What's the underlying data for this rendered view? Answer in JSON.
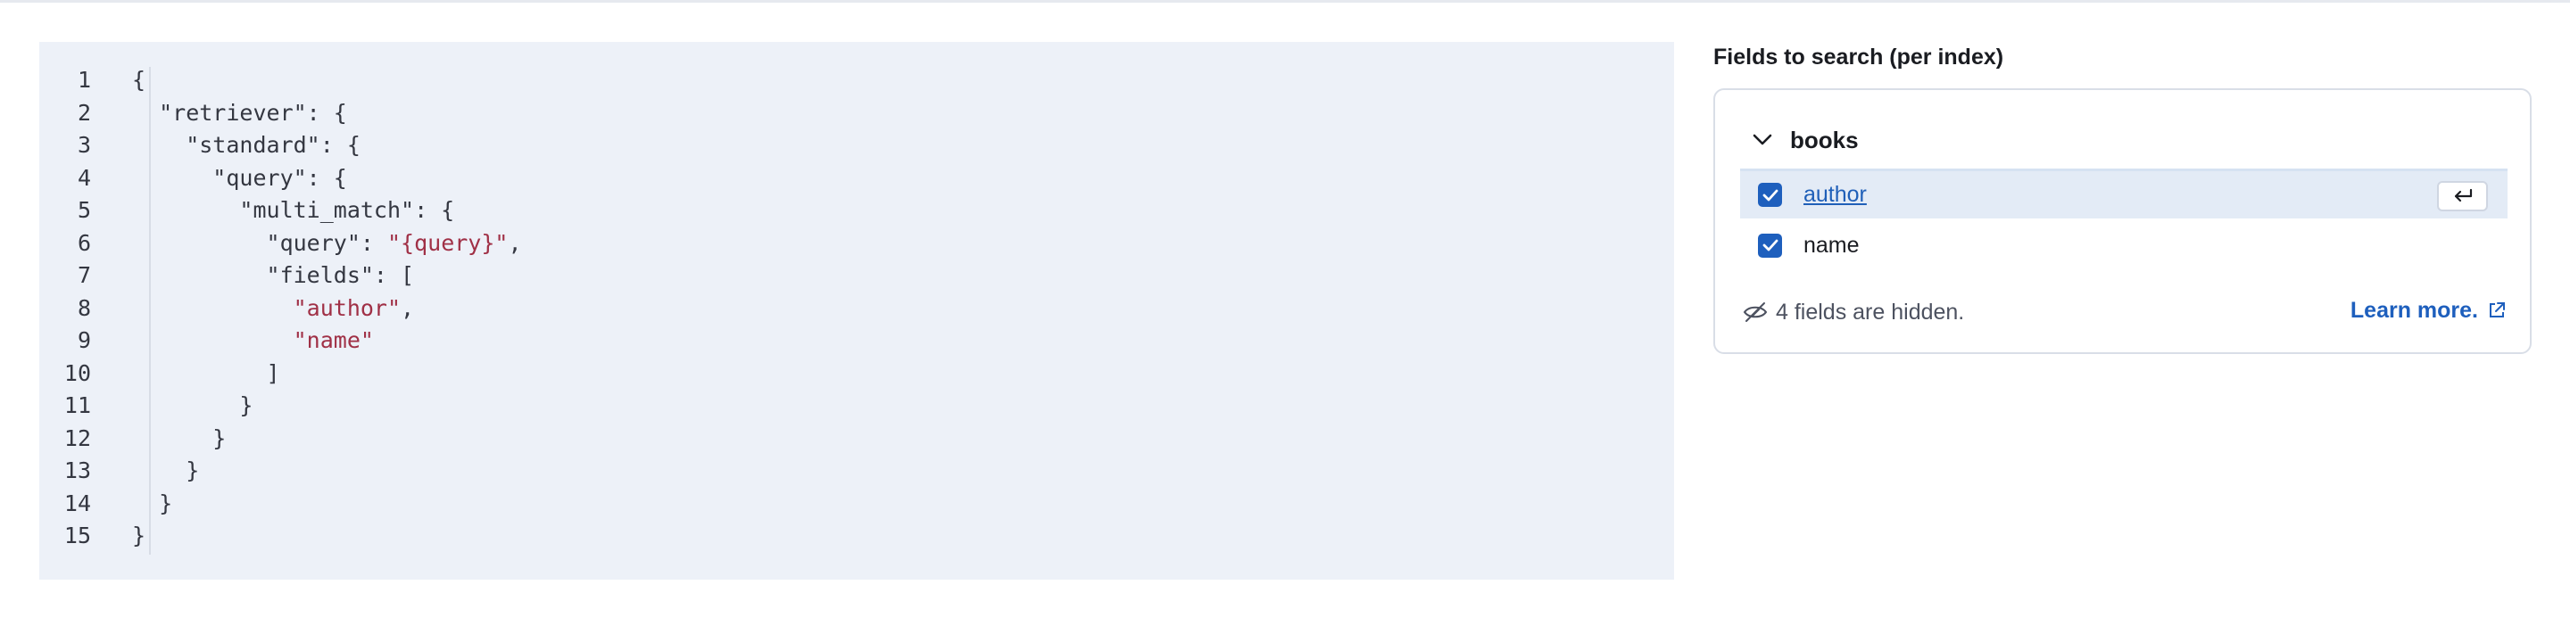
{
  "code_editor": {
    "lines": [
      {
        "num": "1",
        "parts": [
          {
            "t": "{"
          }
        ]
      },
      {
        "num": "2",
        "parts": [
          {
            "t": "  \"retriever\": {"
          }
        ]
      },
      {
        "num": "3",
        "parts": [
          {
            "t": "    \"standard\": {"
          }
        ]
      },
      {
        "num": "4",
        "parts": [
          {
            "t": "      \"query\": {"
          }
        ]
      },
      {
        "num": "5",
        "parts": [
          {
            "t": "        \"multi_match\": {"
          }
        ]
      },
      {
        "num": "6",
        "parts": [
          {
            "t": "          \"query\": "
          },
          {
            "t": "\"{query}\"",
            "s": true
          },
          {
            "t": ","
          }
        ]
      },
      {
        "num": "7",
        "parts": [
          {
            "t": "          \"fields\": ["
          }
        ]
      },
      {
        "num": "8",
        "parts": [
          {
            "t": "            "
          },
          {
            "t": "\"author\"",
            "s": true
          },
          {
            "t": ","
          }
        ]
      },
      {
        "num": "9",
        "parts": [
          {
            "t": "            "
          },
          {
            "t": "\"name\"",
            "s": true
          }
        ]
      },
      {
        "num": "10",
        "parts": [
          {
            "t": "          ]"
          }
        ]
      },
      {
        "num": "11",
        "parts": [
          {
            "t": "        }"
          }
        ]
      },
      {
        "num": "12",
        "parts": [
          {
            "t": "      }"
          }
        ]
      },
      {
        "num": "13",
        "parts": [
          {
            "t": "    }"
          }
        ]
      },
      {
        "num": "14",
        "parts": [
          {
            "t": "  }"
          }
        ]
      },
      {
        "num": "15",
        "parts": [
          {
            "t": "}"
          }
        ]
      }
    ]
  },
  "fields_panel": {
    "title": "Fields to search (per index)",
    "index": {
      "name": "books",
      "expanded": true,
      "fields": [
        {
          "label": "author",
          "checked": true,
          "highlighted": true
        },
        {
          "label": "name",
          "checked": true,
          "highlighted": false
        }
      ],
      "hidden_note": "4 fields are hidden.",
      "learn_more": "Learn more."
    },
    "icons": {
      "chevron": "chevron-down-icon",
      "checkbox": "checkmark-icon",
      "enter": "enter-key-icon",
      "hidden": "eye-closed-icon",
      "external": "external-link-icon"
    }
  },
  "colors": {
    "code_bg": "#edf1f8",
    "string": "#a03046",
    "accent": "#1e5fbd",
    "row_highlight": "#e3ebf6"
  }
}
